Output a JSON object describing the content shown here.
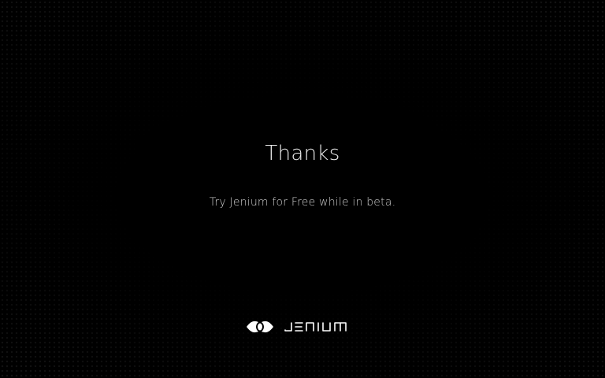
{
  "page": {
    "title": "Thanks",
    "subtitle": "Try Jenium for Free while in beta."
  },
  "brand": {
    "name": "JENIUM",
    "icon": "eye-logo-icon"
  },
  "colors": {
    "background": "#000000",
    "text_primary": "#e9e9e9",
    "text_secondary": "#c9c9c9"
  }
}
